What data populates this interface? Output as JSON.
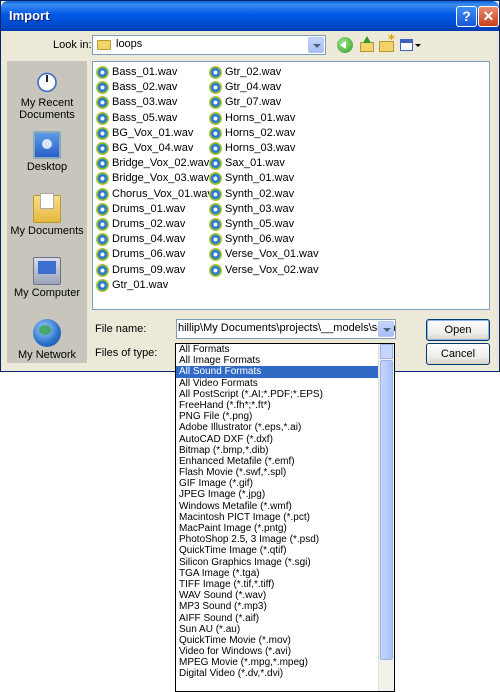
{
  "window": {
    "title": "Import",
    "help_glyph": "?",
    "close_glyph": "✕"
  },
  "toolbar": {
    "lookin_label": "Look in:",
    "lookin_value": "loops",
    "icons": [
      "back-icon",
      "up-folder-icon",
      "new-folder-icon",
      "views-menu-icon"
    ]
  },
  "places": [
    {
      "label": "My Recent Documents",
      "icon": "recent-documents-icon"
    },
    {
      "label": "Desktop",
      "icon": "desktop-icon"
    },
    {
      "label": "My Documents",
      "icon": "my-documents-icon"
    },
    {
      "label": "My Computer",
      "icon": "my-computer-icon"
    },
    {
      "label": "My Network",
      "icon": "my-network-icon"
    }
  ],
  "files": [
    "Bass_01.wav",
    "Bass_02.wav",
    "Bass_03.wav",
    "Bass_05.wav",
    "BG_Vox_01.wav",
    "BG_Vox_04.wav",
    "Bridge_Vox_02.wav",
    "Bridge_Vox_03.wav",
    "Chorus_Vox_01.wav",
    "Drums_01.wav",
    "Drums_02.wav",
    "Drums_04.wav",
    "Drums_06.wav",
    "Drums_09.wav",
    "Gtr_01.wav",
    "Gtr_02.wav",
    "Gtr_04.wav",
    "Gtr_07.wav",
    "Horns_01.wav",
    "Horns_02.wav",
    "Horns_03.wav",
    "Sax_01.wav",
    "Synth_01.wav",
    "Synth_02.wav",
    "Synth_03.wav",
    "Synth_05.wav",
    "Synth_06.wav",
    "Verse_Vox_01.wav",
    "Verse_Vox_02.wav"
  ],
  "form": {
    "filename_label": "File name:",
    "filename_value": "hillip\\My Documents\\projects\\__models\\sounds",
    "filetype_label": "Files of type:",
    "open_label": "Open",
    "cancel_label": "Cancel"
  },
  "filetypes": {
    "selected_index": 2,
    "options": [
      "All Formats",
      "All Image Formats",
      "All Sound Formats",
      "All Video Formats",
      "All PostScript (*.AI;*.PDF;*.EPS)",
      "FreeHand (*.fh*;*.ft*)",
      "PNG File (*.png)",
      "Adobe Illustrator (*.eps,*.ai)",
      "AutoCAD DXF (*.dxf)",
      "Bitmap (*.bmp,*.dib)",
      "Enhanced Metafile (*.emf)",
      "Flash Movie (*.swf,*.spl)",
      "GIF Image (*.gif)",
      "JPEG Image (*.jpg)",
      "Windows Metafile (*.wmf)",
      "Macintosh PICT Image (*.pct)",
      "MacPaint Image (*.pntg)",
      "PhotoShop 2.5, 3 Image (*.psd)",
      "QuickTime Image (*.qtif)",
      "Silicon Graphics Image (*.sgi)",
      "TGA Image (*.tga)",
      "TIFF Image (*.tif,*.tiff)",
      "WAV Sound (*.wav)",
      "MP3 Sound (*.mp3)",
      "AIFF Sound (*.aif)",
      "Sun AU (*.au)",
      "QuickTime Movie (*.mov)",
      "Video for Windows (*.avi)",
      "MPEG Movie (*.mpg,*.mpeg)",
      "Digital Video (*.dv,*.dvi)"
    ]
  }
}
